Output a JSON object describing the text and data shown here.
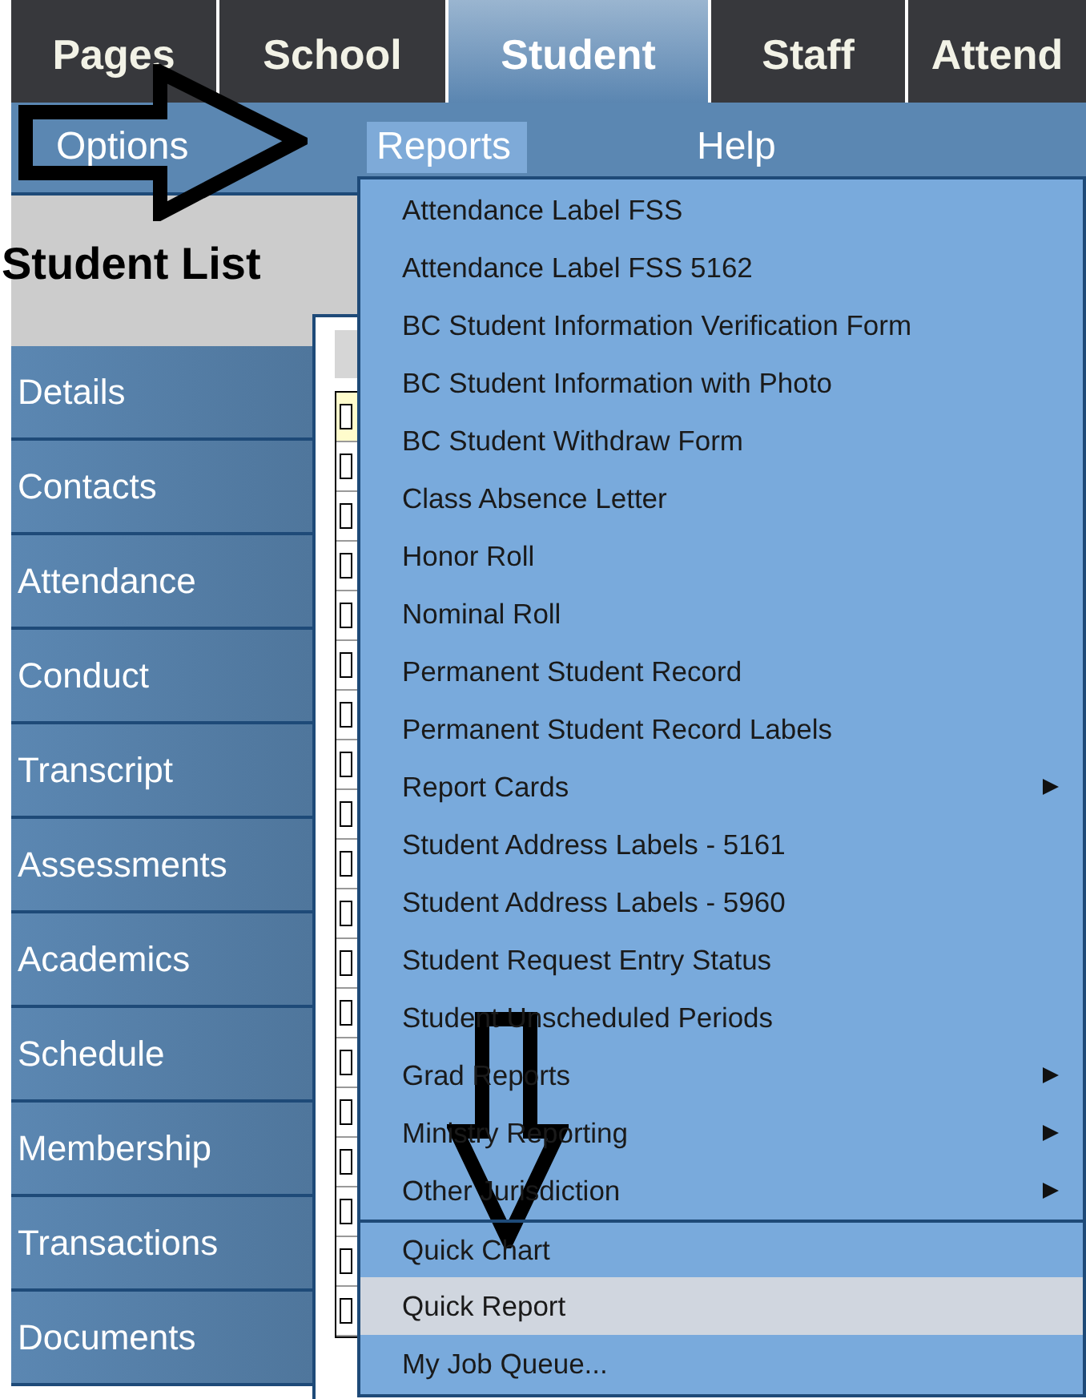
{
  "tabs": [
    {
      "label": "Pages",
      "selected": false
    },
    {
      "label": "School",
      "selected": false
    },
    {
      "label": "Student",
      "selected": true
    },
    {
      "label": "Staff",
      "selected": false
    },
    {
      "label": "Attend",
      "selected": false
    }
  ],
  "menu_bar": [
    {
      "label": "Options",
      "selected": false
    },
    {
      "label": "Reports",
      "selected": true
    },
    {
      "label": "Help",
      "selected": false
    }
  ],
  "page_title": "Student List",
  "sidebar": {
    "items": [
      {
        "label": "Details"
      },
      {
        "label": "Contacts"
      },
      {
        "label": "Attendance"
      },
      {
        "label": "Conduct"
      },
      {
        "label": "Transcript"
      },
      {
        "label": "Assessments"
      },
      {
        "label": "Academics"
      },
      {
        "label": "Schedule"
      },
      {
        "label": "Membership"
      },
      {
        "label": "Transactions"
      },
      {
        "label": "Documents"
      }
    ]
  },
  "reports_menu": [
    {
      "label": "Attendance Label FSS",
      "selected": false,
      "submenu": false,
      "separator_before": false
    },
    {
      "label": "Attendance Label FSS 5162",
      "selected": false,
      "submenu": false,
      "separator_before": false
    },
    {
      "label": "BC Student Information Verification Form",
      "selected": false,
      "submenu": false,
      "separator_before": false
    },
    {
      "label": "BC Student Information with Photo",
      "selected": false,
      "submenu": false,
      "separator_before": false
    },
    {
      "label": "BC Student Withdraw Form",
      "selected": false,
      "submenu": false,
      "separator_before": false
    },
    {
      "label": "Class Absence Letter",
      "selected": false,
      "submenu": false,
      "separator_before": false
    },
    {
      "label": "Honor Roll",
      "selected": false,
      "submenu": false,
      "separator_before": false
    },
    {
      "label": "Nominal Roll",
      "selected": false,
      "submenu": false,
      "separator_before": false
    },
    {
      "label": "Permanent Student Record",
      "selected": false,
      "submenu": false,
      "separator_before": false
    },
    {
      "label": "Permanent Student Record Labels",
      "selected": false,
      "submenu": false,
      "separator_before": false
    },
    {
      "label": "Report Cards",
      "selected": false,
      "submenu": true,
      "separator_before": false
    },
    {
      "label": "Student Address Labels - 5161",
      "selected": false,
      "submenu": false,
      "separator_before": false
    },
    {
      "label": "Student Address Labels - 5960",
      "selected": false,
      "submenu": false,
      "separator_before": false
    },
    {
      "label": "Student Request Entry Status",
      "selected": false,
      "submenu": false,
      "separator_before": false
    },
    {
      "label": "Student Unscheduled Periods",
      "selected": false,
      "submenu": false,
      "separator_before": false
    },
    {
      "label": "Grad Reports",
      "selected": false,
      "submenu": true,
      "separator_before": false
    },
    {
      "label": "Ministry Reporting",
      "selected": false,
      "submenu": true,
      "separator_before": false
    },
    {
      "label": "Other Jurisdiction",
      "selected": false,
      "submenu": true,
      "separator_before": false
    },
    {
      "label": "Quick Chart",
      "selected": false,
      "submenu": false,
      "separator_before": true
    },
    {
      "label": "Quick Report",
      "selected": true,
      "submenu": false,
      "separator_before": false
    },
    {
      "label": "My Job Queue...",
      "selected": false,
      "submenu": false,
      "separator_before": false
    }
  ]
}
